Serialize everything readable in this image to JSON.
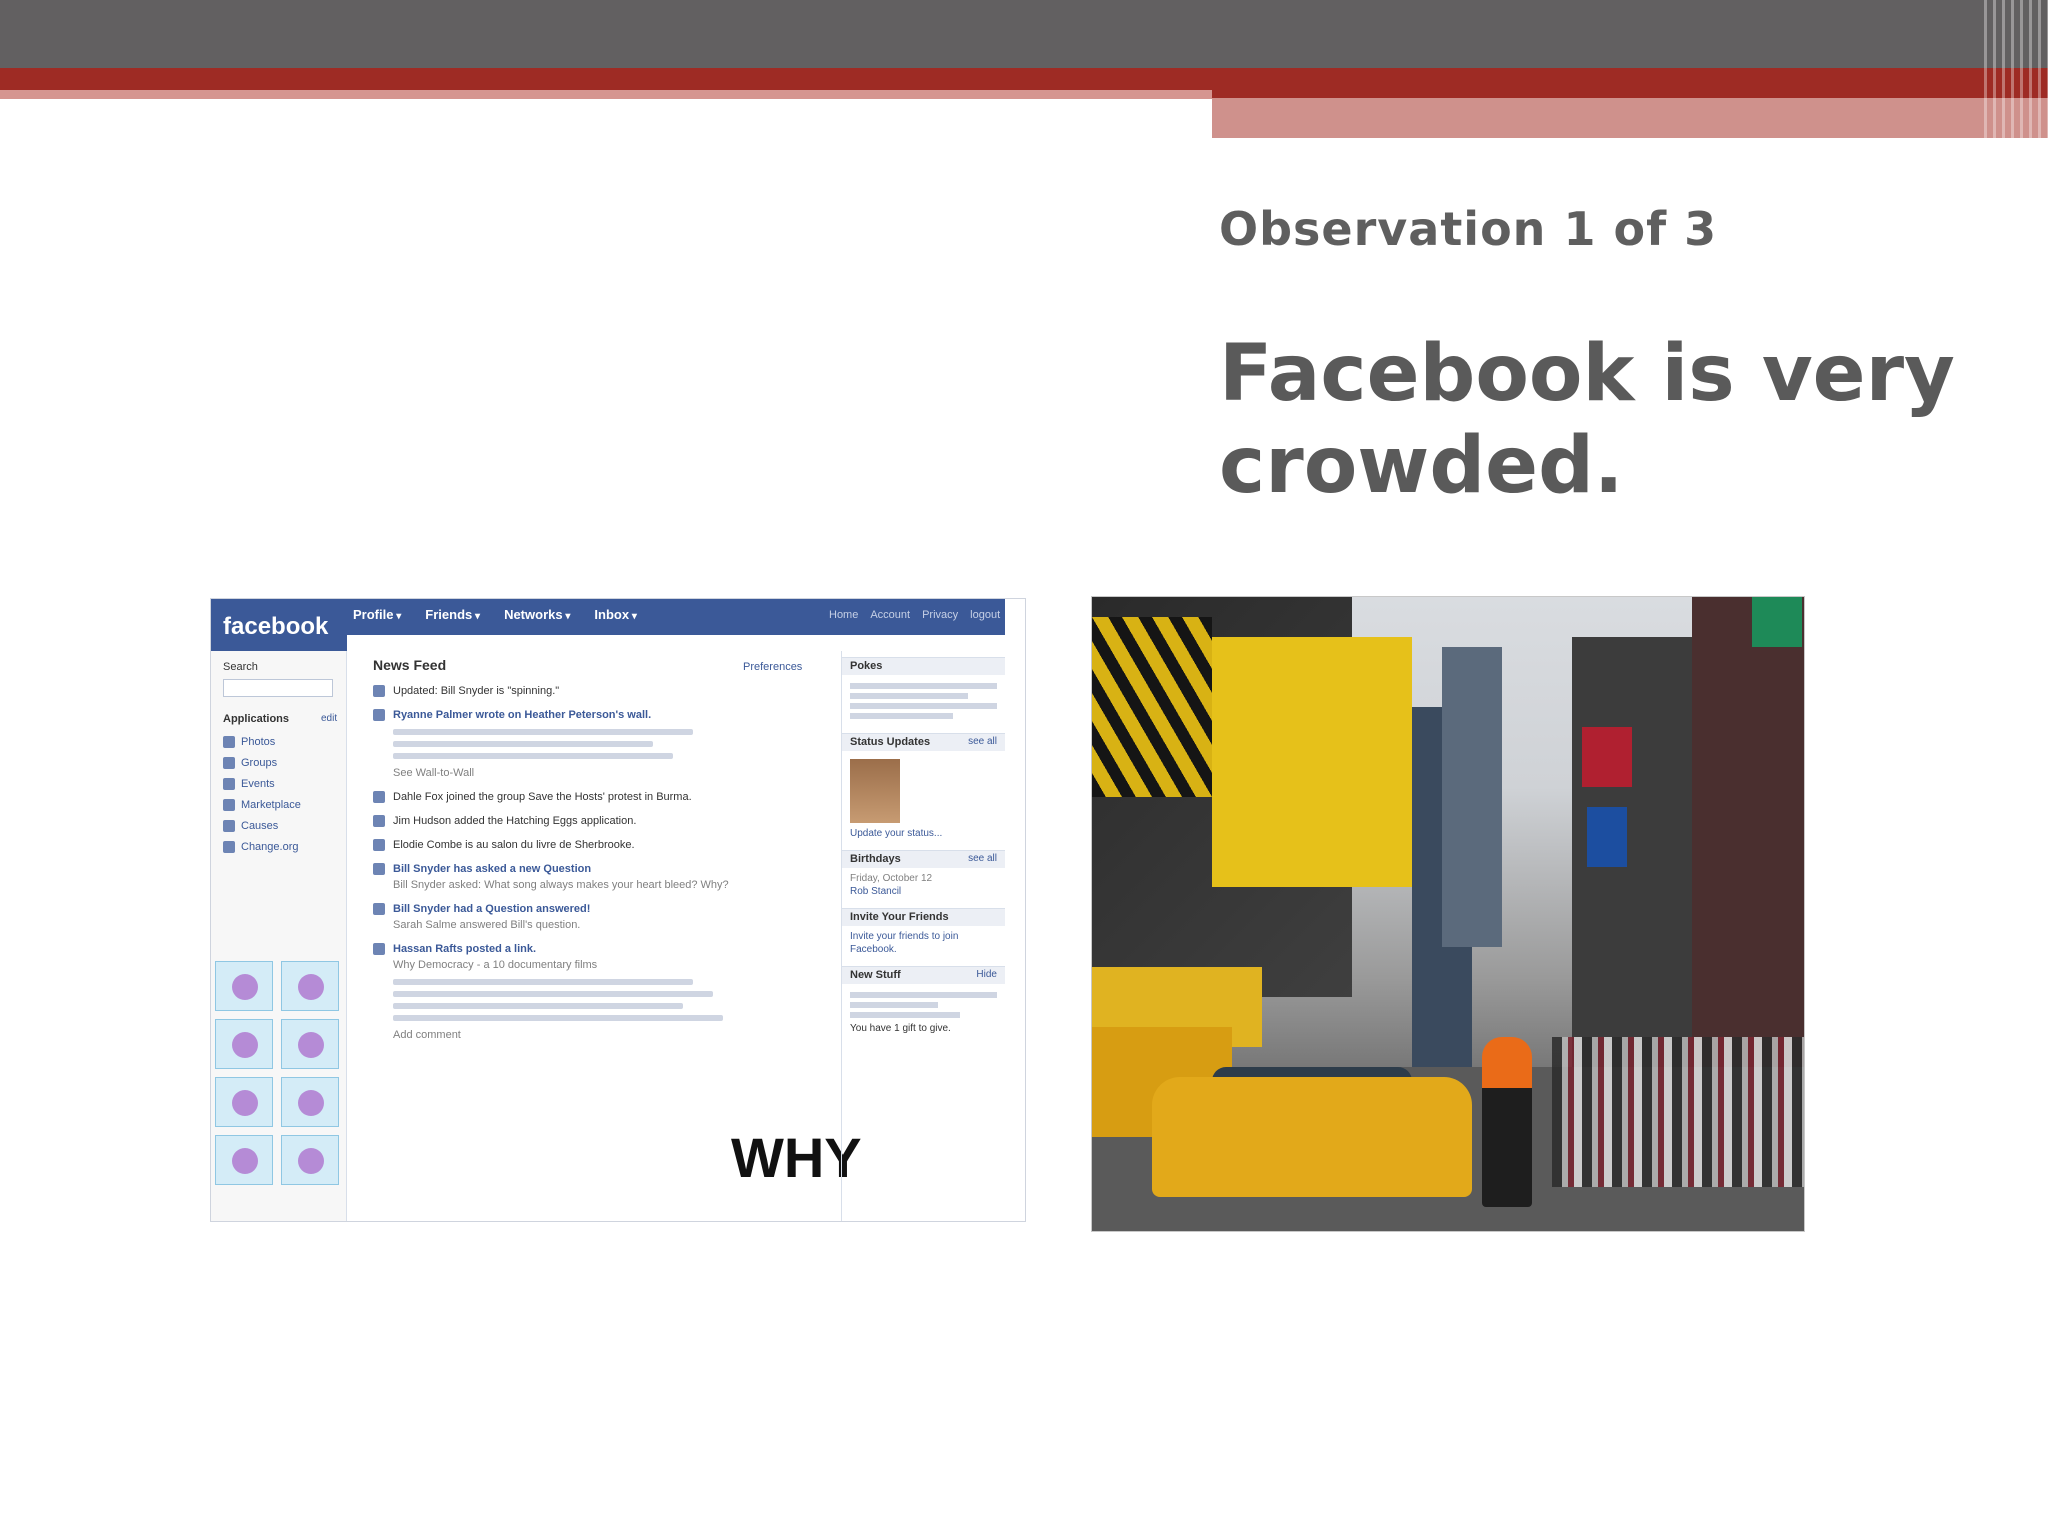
{
  "slide": {
    "subtitle": "Observation 1 of 3",
    "headline": "Facebook is very crowded."
  },
  "facebook_screenshot": {
    "logo": "facebook",
    "nav": [
      "Profile",
      "Friends",
      "Networks",
      "Inbox"
    ],
    "top_links": [
      "Home",
      "Account",
      "Privacy",
      "logout"
    ],
    "sidebar": {
      "search_label": "Search",
      "applications_label": "Applications",
      "edit_label": "edit",
      "apps": [
        "Photos",
        "Groups",
        "Events",
        "Marketplace",
        "Causes",
        "Change.org"
      ]
    },
    "main": {
      "title": "News Feed",
      "preferences": "Preferences",
      "feed_items": [
        {
          "title": "Updated: Bill Snyder is \"spinning.\"",
          "detail": ""
        },
        {
          "title": "Ryanne Palmer wrote on Heather Peterson's wall.",
          "detail": "See Wall-to-Wall"
        },
        {
          "title": "Dahle Fox joined the group Save the Hosts' protest in Burma.",
          "detail": ""
        },
        {
          "title": "Jim Hudson added the Hatching Eggs application.",
          "detail": ""
        },
        {
          "title": "Elodie Combe is au salon du livre de Sherbrooke.",
          "detail": ""
        },
        {
          "title": "Bill Snyder has asked a new Question",
          "detail": "Bill Snyder asked: What song always makes your heart bleed? Why?"
        },
        {
          "title": "Bill Snyder had a Question answered!",
          "detail": "Sarah Salme answered Bill's question."
        },
        {
          "title": "Hassan Rafts posted a link.",
          "detail": "Why Democracy - a 10 documentary films"
        }
      ],
      "why_text": "WHY",
      "add_comment": "Add comment"
    },
    "right": {
      "pokes": "Pokes",
      "status_updates": "Status Updates",
      "see_all": "see all",
      "update_status": "Update your status...",
      "birthdays": "Birthdays",
      "birthday_date": "Friday, October 12",
      "birthday_name": "Rob Stancil",
      "invite": "Invite Your Friends",
      "invite_text": "Invite your friends to join Facebook.",
      "new_stuff": "New Stuff",
      "hide": "Hide",
      "gift_text": "You have 1 gift to give."
    }
  },
  "photo": {
    "subject": "times-square-street-scene"
  },
  "colors": {
    "header_grey": "#626061",
    "header_red": "#9e2b24",
    "header_pink": "#cf918c",
    "text_grey": "#5a5a5a",
    "facebook_blue": "#3b5998"
  }
}
